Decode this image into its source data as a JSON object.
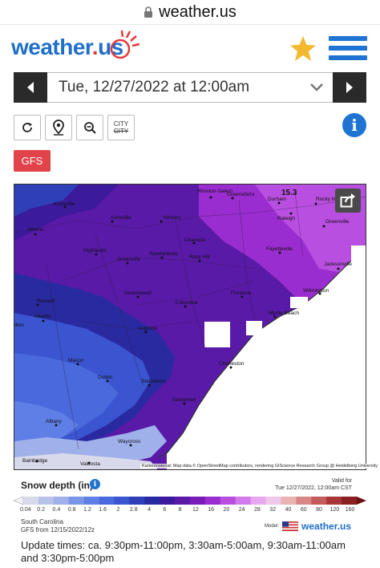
{
  "browser": {
    "url": "weather.us"
  },
  "header": {
    "logo_text": "weather",
    "logo_dot": ".",
    "logo_tld": "us",
    "brand_color": "#1f6fc9",
    "accent_color": "#e33a3a"
  },
  "datebar": {
    "selected_date": "Tue, 12/27/2022 at 12:00am"
  },
  "tools": {
    "city_line1": "CITY",
    "city_line2": "CITY"
  },
  "model_button": {
    "label": "GFS",
    "color": "#e2434b"
  },
  "map": {
    "value_label": "15.3",
    "cities": [
      "Knoxville",
      "Asheville",
      "Hickory",
      "Winston-Salem",
      "Greensboro",
      "Durham",
      "Rocky Mount",
      "Raleigh",
      "Greenville",
      "Athens",
      "Highlands",
      "Charlotte",
      "Greenville",
      "Spartanburg",
      "Rock Hill",
      "Fayetteville",
      "Jacksonville",
      "Roswell",
      "Atlanta",
      "Greenwood",
      "Columbia",
      "Florence",
      "Wilmington",
      "Myrtle Beach",
      "Augusta",
      "Charleston",
      "Macon",
      "Dublin",
      "Statesboro",
      "Savannah",
      "Albany",
      "Waycross",
      "Valdosta",
      "Bainbridge",
      "ilton"
    ],
    "attribution": "Kartenmaterial: Map data © OpenStreetMap contributors, rendering GIScience Research Group @ Heidelberg University"
  },
  "legend": {
    "title": "Snow depth (in)",
    "valid_label": "Valid for",
    "valid_time": "Tue 12/27/2022, 12:00am CST",
    "ticks": [
      "0.04",
      "0.2",
      "0.4",
      "0.8",
      "1.2",
      "1.6",
      "2",
      "2.8",
      "4",
      "6",
      "8",
      "12",
      "16",
      "20",
      "24",
      "28",
      "32",
      "40",
      "60",
      "80",
      "120",
      "160"
    ],
    "colors": [
      "#d9d9ec",
      "#b9c3e9",
      "#9fb0ea",
      "#7a95e8",
      "#5f7fe6",
      "#4a69dd",
      "#3a55cf",
      "#2f3fb8",
      "#2a2aa0",
      "#3b1a9c",
      "#5a1aa8",
      "#7a1db8",
      "#9a2dcf",
      "#b94fe0",
      "#d27aec",
      "#e7a6f0",
      "#efc7e8",
      "#e8b3b3",
      "#d88686",
      "#c45a5a",
      "#a83636",
      "#8a1f1f"
    ]
  },
  "region": {
    "name": "South Carolina",
    "run": "GFS from 12/15/2022/12z"
  },
  "model_credit": {
    "label": "Model:",
    "logo": "weather.us"
  },
  "update": {
    "text": "Update times: ca. 9:30pm-11:00pm, 3:30am-5:00am, 9:30am-11:00am and 3:30pm-5:00pm"
  }
}
